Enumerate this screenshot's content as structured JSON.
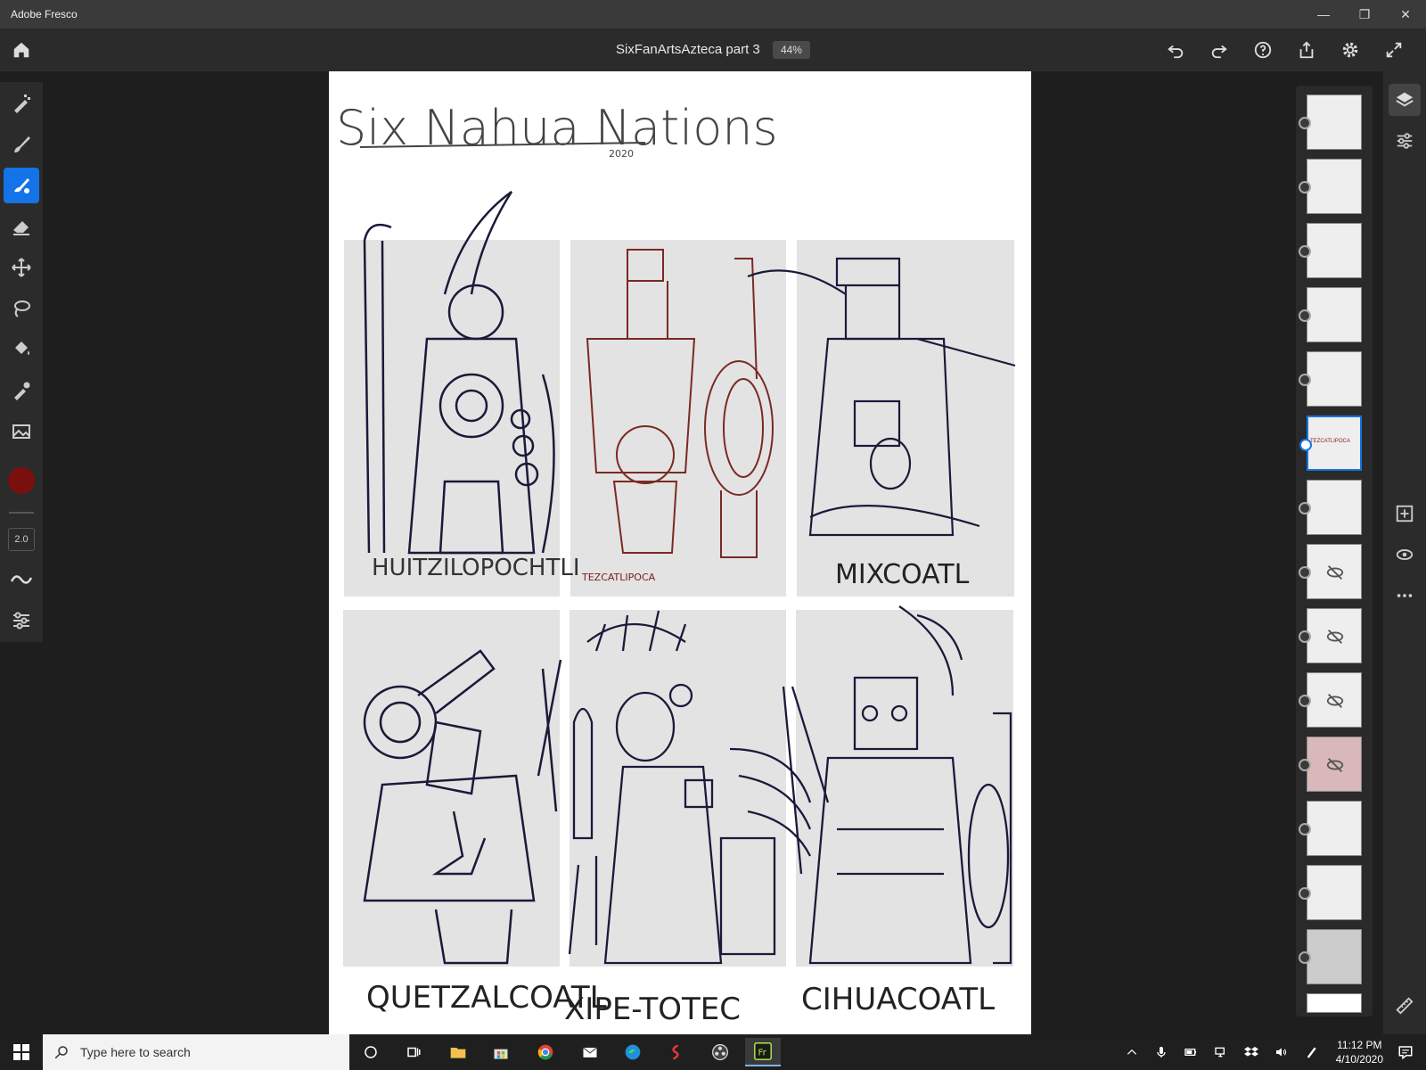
{
  "window": {
    "app_title": "Adobe Fresco",
    "minimize": "—",
    "maximize": "❐",
    "close": "✕"
  },
  "appbar": {
    "doc_title": "SixFanArtsAzteca part 3",
    "zoom": "44%"
  },
  "tools": {
    "brush_size": "2.0",
    "active_color": "#7a0f0f",
    "accent": "#1473e6"
  },
  "artwork": {
    "title": "Six Nahua Nations",
    "year": "2020",
    "figures": [
      "HUITZILOPOCHTLI",
      "TEZCATLIPOCA",
      "MIXCOATL",
      "QUETZALCOATL",
      "XIPE-TOTEC",
      "CIHUACOATL"
    ]
  },
  "layers": {
    "thumb_label": "TEZCATLIPOCA"
  },
  "taskbar": {
    "search_placeholder": "Type here to search",
    "time": "11:12 PM",
    "date": "4/10/2020"
  }
}
